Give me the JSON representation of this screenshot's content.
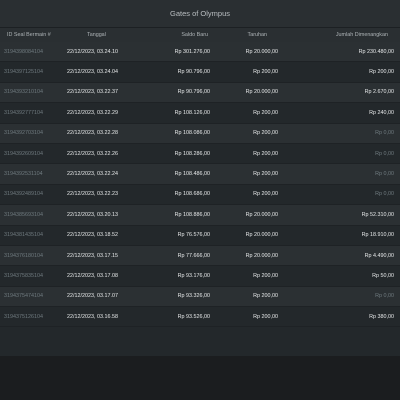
{
  "window": {
    "title": "Gates of Olympus"
  },
  "table": {
    "headers": {
      "id": "ID Seal Bermain #",
      "date": "Tanggal",
      "saldo": "Saldo Baru",
      "bet": "Taruhan",
      "win": "Jumlah Dimenangkan"
    },
    "rows": [
      {
        "id": "3194398084104",
        "date": "22/12/2023, 03.24.10",
        "saldo": "Rp 301.276,00",
        "bet": "Rp 20.000,00",
        "win": "Rp 230.480,00",
        "zero": false
      },
      {
        "id": "3194397125104",
        "date": "22/12/2023, 03.24.04",
        "saldo": "Rp 90.796,00",
        "bet": "Rp 200,00",
        "win": "Rp 200,00",
        "zero": false
      },
      {
        "id": "3194393210104",
        "date": "22/12/2023, 03.22.37",
        "saldo": "Rp 90.796,00",
        "bet": "Rp 20.000,00",
        "win": "Rp 2.670,00",
        "zero": false
      },
      {
        "id": "3194392777104",
        "date": "22/12/2023, 03.22.29",
        "saldo": "Rp 108.126,00",
        "bet": "Rp 200,00",
        "win": "Rp 240,00",
        "zero": false
      },
      {
        "id": "3194392703104",
        "date": "22/12/2023, 03.22.28",
        "saldo": "Rp 108.086,00",
        "bet": "Rp 200,00",
        "win": "Rp 0,00",
        "zero": true
      },
      {
        "id": "3194392609104",
        "date": "22/12/2023, 03.22.26",
        "saldo": "Rp 108.286,00",
        "bet": "Rp 200,00",
        "win": "Rp 0,00",
        "zero": true
      },
      {
        "id": "3194392531104",
        "date": "22/12/2023, 03.22.24",
        "saldo": "Rp 108.486,00",
        "bet": "Rp 200,00",
        "win": "Rp 0,00",
        "zero": true
      },
      {
        "id": "3194392489104",
        "date": "22/12/2023, 03.22.23",
        "saldo": "Rp 108.686,00",
        "bet": "Rp 200,00",
        "win": "Rp 0,00",
        "zero": true
      },
      {
        "id": "3194385693104",
        "date": "22/12/2023, 03.20.13",
        "saldo": "Rp 108.886,00",
        "bet": "Rp 20.000,00",
        "win": "Rp 52.310,00",
        "zero": false
      },
      {
        "id": "3194381435104",
        "date": "22/12/2023, 03.18.52",
        "saldo": "Rp 76.576,00",
        "bet": "Rp 20.000,00",
        "win": "Rp 18.910,00",
        "zero": false
      },
      {
        "id": "3194376180104",
        "date": "22/12/2023, 03.17.15",
        "saldo": "Rp 77.666,00",
        "bet": "Rp 20.000,00",
        "win": "Rp 4.490,00",
        "zero": false
      },
      {
        "id": "3194375835104",
        "date": "22/12/2023, 03.17.08",
        "saldo": "Rp 93.176,00",
        "bet": "Rp 200,00",
        "win": "Rp 50,00",
        "zero": false
      },
      {
        "id": "3194375474104",
        "date": "22/12/2023, 03.17.07",
        "saldo": "Rp 93.326,00",
        "bet": "Rp 200,00",
        "win": "Rp 0,00",
        "zero": true
      },
      {
        "id": "3194375126104",
        "date": "22/12/2023, 03.16.58",
        "saldo": "Rp 93.526,00",
        "bet": "Rp 200,00",
        "win": "Rp 380,00",
        "zero": false
      }
    ]
  }
}
